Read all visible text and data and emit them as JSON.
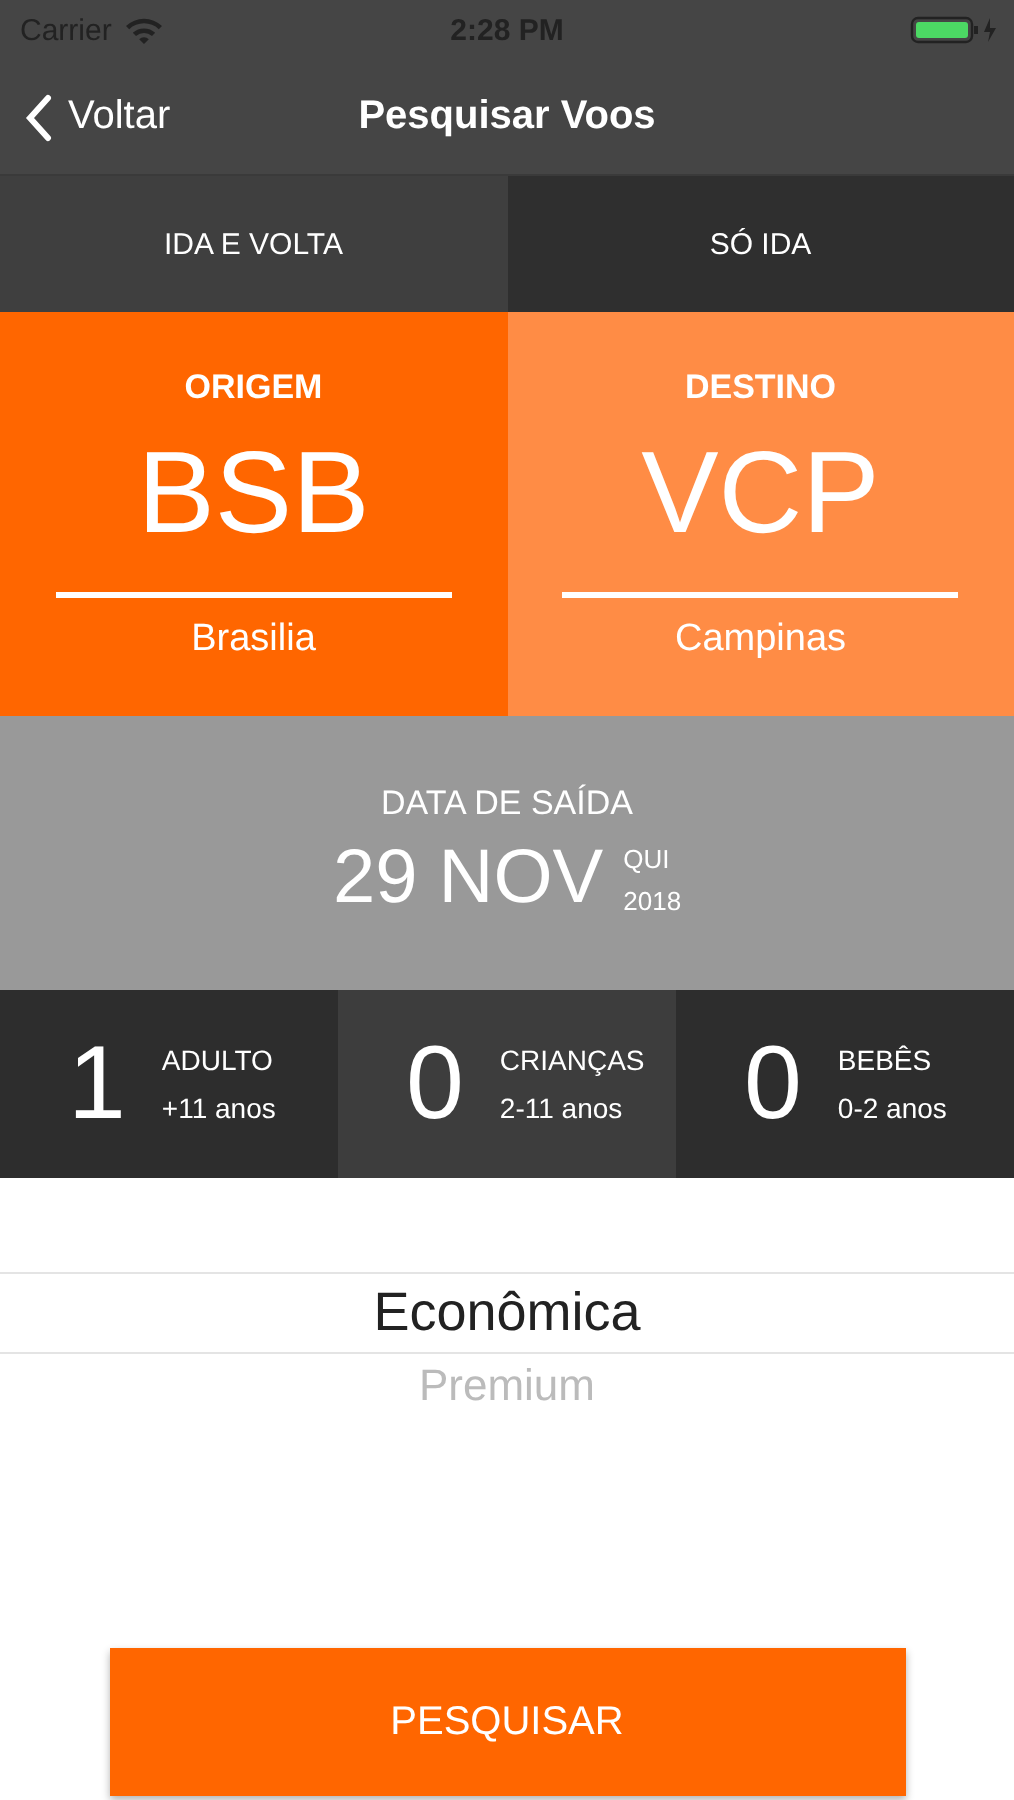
{
  "status_bar": {
    "carrier": "Carrier",
    "time": "2:28 PM"
  },
  "nav": {
    "back": "Voltar",
    "title": "Pesquisar Voos"
  },
  "tabs": [
    {
      "label": "IDA E VOLTA",
      "selected": true
    },
    {
      "label": "SÓ IDA",
      "selected": false
    }
  ],
  "airports": [
    {
      "label": "ORIGEM",
      "code": "BSB",
      "city": "Brasilia",
      "selected": true
    },
    {
      "label": "DESTINO",
      "code": "VCP",
      "city": "Campinas",
      "selected": false
    }
  ],
  "departure": {
    "label": "DATA DE SAÍDA",
    "date": "29 NOV",
    "weekday": "QUI",
    "year": "2018"
  },
  "passengers": [
    {
      "count": "1",
      "type": "ADULTO",
      "ages": "+11 anos"
    },
    {
      "count": "0",
      "type": "CRIANÇAS",
      "ages": "2-11 anos"
    },
    {
      "count": "0",
      "type": "BEBÊS",
      "ages": "0-2 anos"
    }
  ],
  "cabin_options": [
    {
      "label": "Econômica",
      "selected": true
    },
    {
      "label": "Premium",
      "selected": false
    }
  ],
  "search_button": "PESQUISAR"
}
